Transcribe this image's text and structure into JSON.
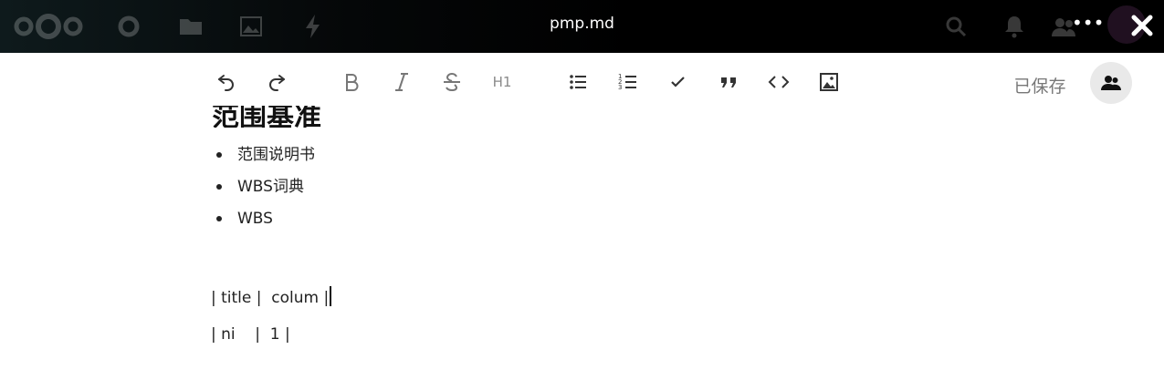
{
  "header": {
    "file_title": "pmp.md",
    "more_label": "•••",
    "icons": [
      "nextcloud-logo-icon",
      "circle-icon",
      "folder-icon",
      "image-icon",
      "activity-icon",
      "search-icon",
      "bell-icon",
      "contacts-icon"
    ],
    "close_icon": "close-icon"
  },
  "toolbar": {
    "buttons": [
      "undo-icon",
      "redo-icon",
      "bold-icon",
      "italic-icon",
      "strikethrough-icon",
      "heading-icon",
      "bullet-list-icon",
      "ordered-list-icon",
      "checkbox-icon",
      "quote-icon",
      "code-icon",
      "image-icon"
    ],
    "heading_label": "H1",
    "save_status": "已保存",
    "share_icon": "people-icon"
  },
  "document": {
    "heading": "范围基准",
    "bullets": [
      "范围说明书",
      "WBS词典",
      "WBS"
    ],
    "paragraphs": [
      "| title |  colum |",
      "| ni    |  1 |"
    ]
  }
}
